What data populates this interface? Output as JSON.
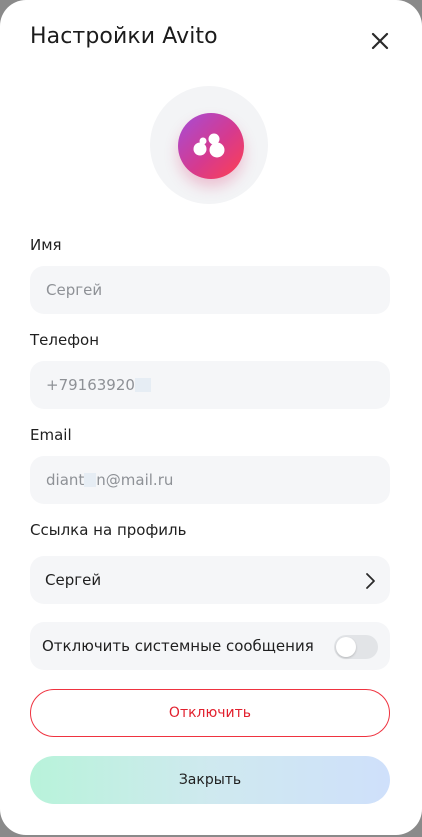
{
  "header": {
    "title": "Настройки Avito"
  },
  "avatar": {
    "icon": "avito-logo-icon"
  },
  "form": {
    "name_label": "Имя",
    "name_value": "Сергей",
    "phone_label": "Телефон",
    "phone_value": "+79163920",
    "email_label": "Email",
    "email_value_start": "diant",
    "email_value_end": "n@mail.ru",
    "profile_link_label": "Ссылка на профиль",
    "profile_link_value": "Сергей"
  },
  "settings": {
    "disable_system_messages_label": "Отключить системные сообщения",
    "disable_system_messages_on": false
  },
  "actions": {
    "disconnect_label": "Отключить",
    "close_label": "Закрыть"
  },
  "colors": {
    "accent_red": "#ef3340",
    "field_bg": "#f5f6f8"
  }
}
